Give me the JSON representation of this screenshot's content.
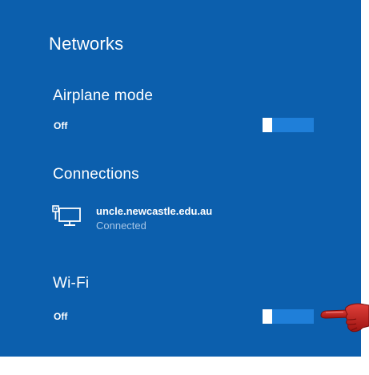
{
  "panel": {
    "title": "Networks",
    "background_color": "#0c5fad"
  },
  "airplane_mode": {
    "heading": "Airplane mode",
    "state": "Off",
    "toggle_on": false
  },
  "connections": {
    "heading": "Connections",
    "items": [
      {
        "name": "uncle.newcastle.edu.au",
        "status": "Connected",
        "icon": "ethernet-monitor-icon"
      }
    ]
  },
  "wifi": {
    "heading": "Wi-Fi",
    "state": "Off",
    "toggle_on": false
  },
  "annotation": {
    "icon": "pointing-hand-icon",
    "color": "#c0201c"
  }
}
